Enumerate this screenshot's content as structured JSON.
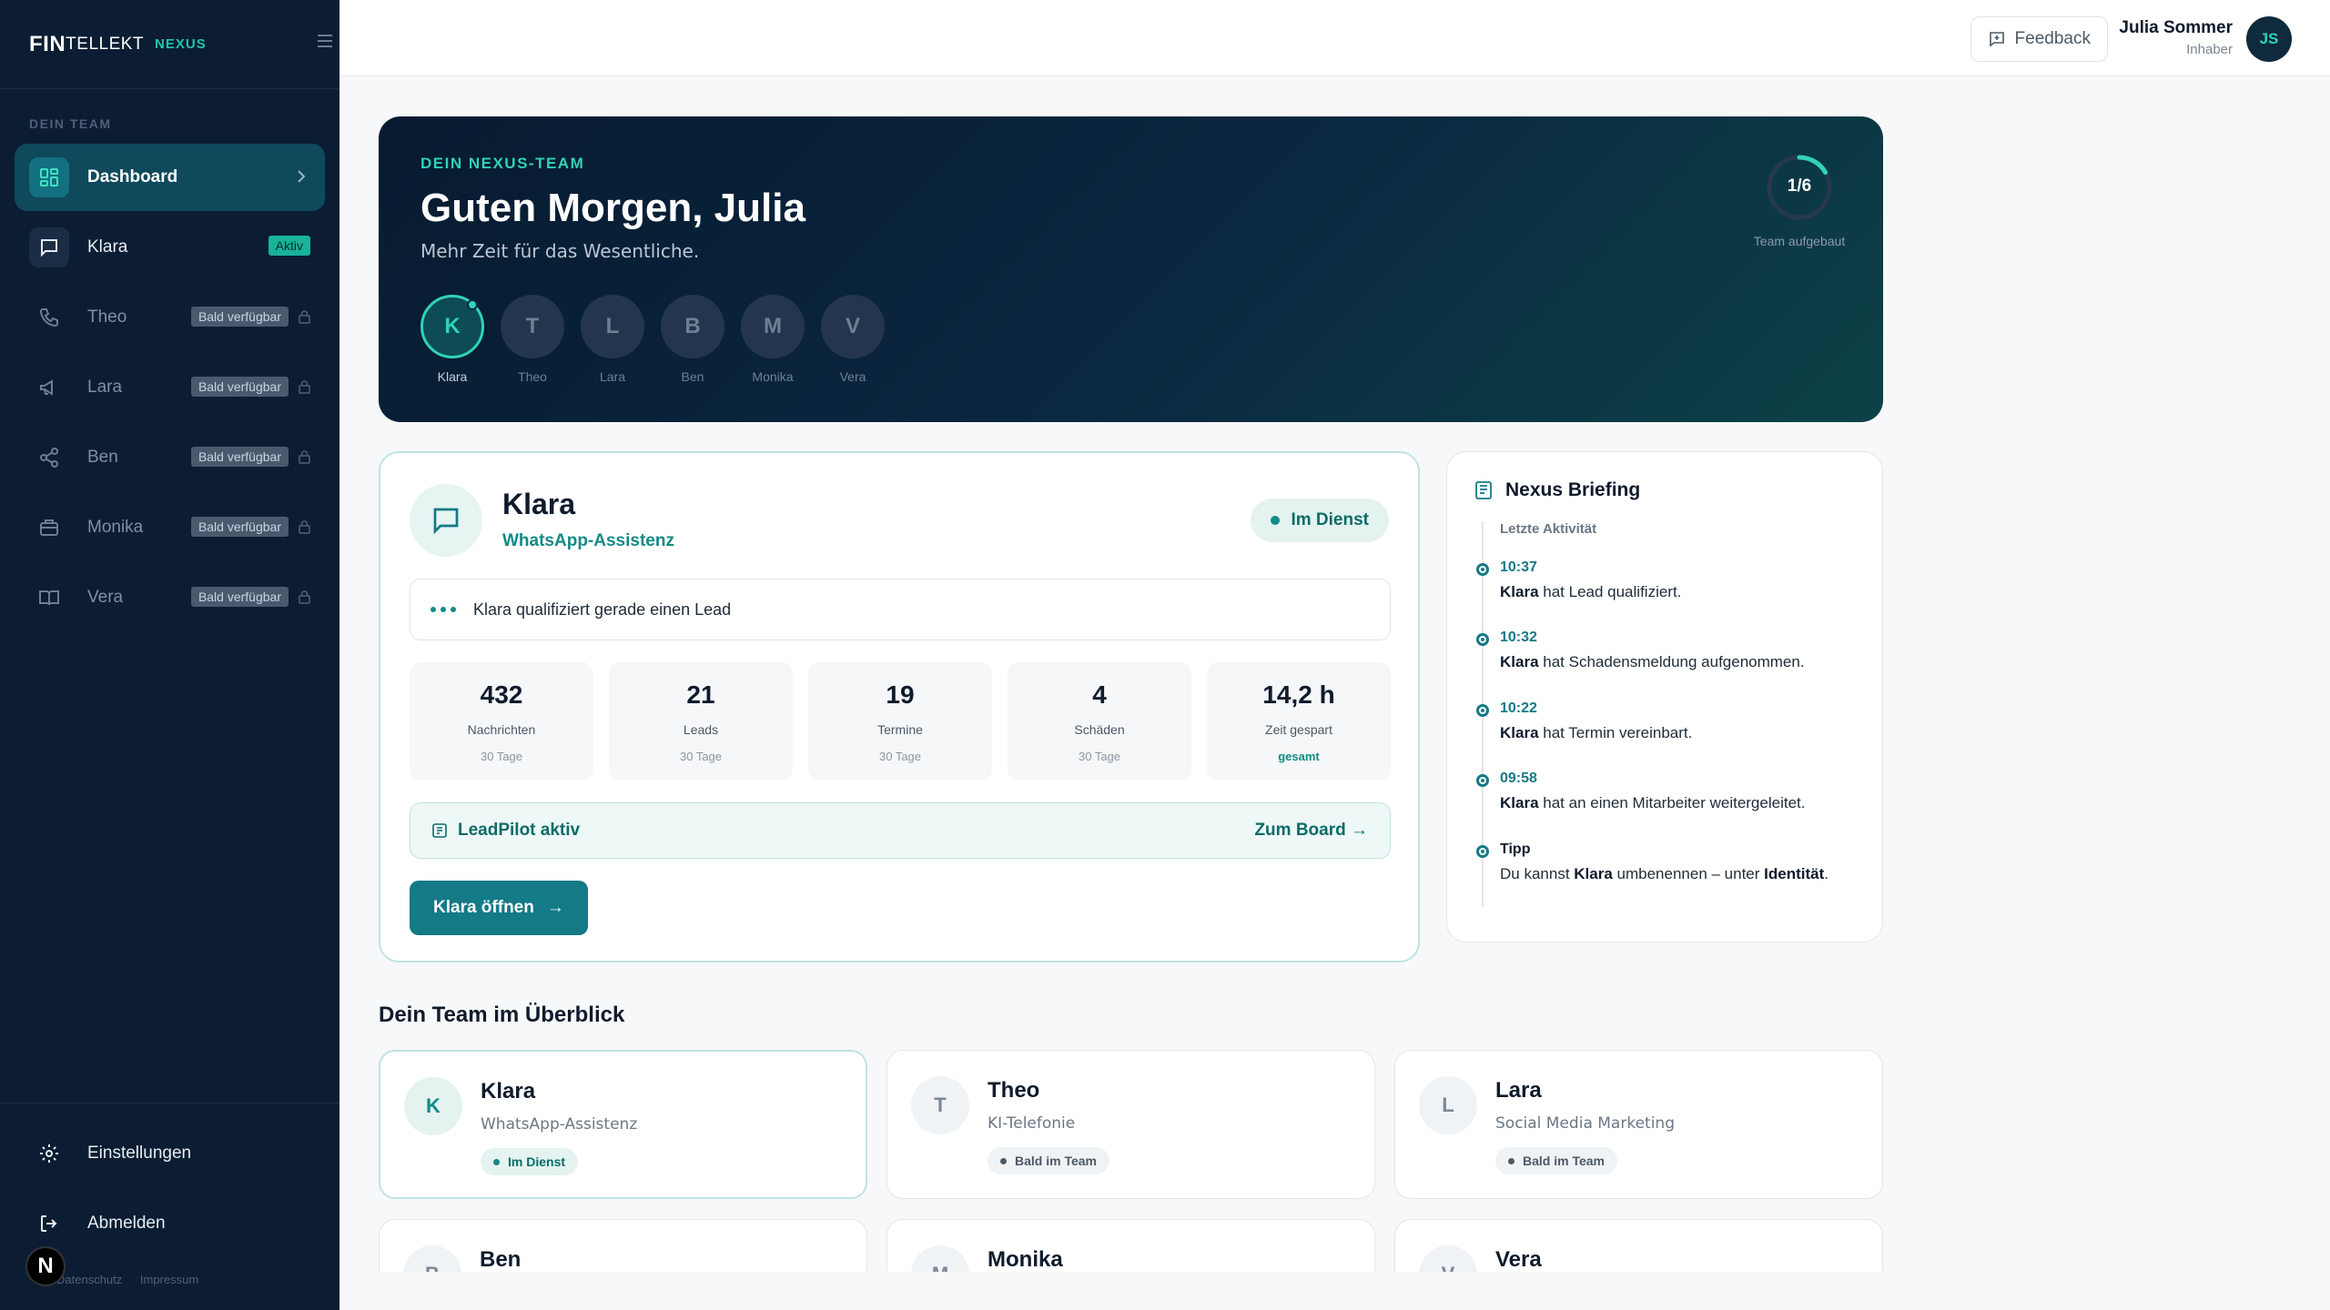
{
  "brand": {
    "fin": "FIN",
    "tellekt": "TELLEKT",
    "nexus": "NEXUS"
  },
  "sidebar": {
    "section_label": "DEIN TEAM",
    "items": [
      {
        "label": "Dashboard",
        "icon": "grid-icon",
        "active": true
      },
      {
        "label": "Klara",
        "icon": "chat-icon",
        "badge": "Aktiv"
      },
      {
        "label": "Theo",
        "icon": "phone-icon",
        "badge": "Bald verfügbar"
      },
      {
        "label": "Lara",
        "icon": "megaphone-icon",
        "badge": "Bald verfügbar"
      },
      {
        "label": "Ben",
        "icon": "share-icon",
        "badge": "Bald verfügbar"
      },
      {
        "label": "Monika",
        "icon": "inbox-icon",
        "badge": "Bald verfügbar"
      },
      {
        "label": "Vera",
        "icon": "book-icon",
        "badge": "Bald verfügbar"
      }
    ],
    "settings_label": "Einstellungen",
    "logout_label": "Abmelden",
    "legal_privacy": "Datenschutz",
    "legal_imprint": "Impressum",
    "n_badge": "N"
  },
  "topbar": {
    "feedback_label": "Feedback",
    "user_name": "Julia Sommer",
    "user_role": "Inhaber",
    "user_initials": "JS"
  },
  "hero": {
    "kicker": "DEIN NEXUS-TEAM",
    "title": "Guten Morgen, Julia",
    "subtitle": "Mehr Zeit für das Wesentliche.",
    "members": [
      {
        "initial": "K",
        "name": "Klara"
      },
      {
        "initial": "T",
        "name": "Theo"
      },
      {
        "initial": "L",
        "name": "Lara"
      },
      {
        "initial": "B",
        "name": "Ben"
      },
      {
        "initial": "M",
        "name": "Monika"
      },
      {
        "initial": "V",
        "name": "Vera"
      }
    ],
    "progress_value": "1/6",
    "progress_fraction": 0.1667,
    "progress_caption": "Team aufgebaut"
  },
  "agent": {
    "name": "Klara",
    "role": "WhatsApp-Assistenz",
    "status": "Im Dienst",
    "activity": "Klara qualifiziert gerade einen Lead",
    "stats": [
      {
        "value": "432",
        "label": "Nachrichten",
        "sub": "30 Tage"
      },
      {
        "value": "21",
        "label": "Leads",
        "sub": "30 Tage"
      },
      {
        "value": "19",
        "label": "Termine",
        "sub": "30 Tage"
      },
      {
        "value": "4",
        "label": "Schäden",
        "sub": "30 Tage"
      },
      {
        "value": "14,2 h",
        "label": "Zeit gespart",
        "sub": "gesamt"
      }
    ],
    "leadpilot_label": "LeadPilot aktiv",
    "leadpilot_link": "Zum Board",
    "open_button": "Klara öffnen"
  },
  "briefing": {
    "title": "Nexus Briefing",
    "section": "Letzte Aktivität",
    "items": [
      {
        "time": "10:37",
        "actor": "Klara",
        "text": " hat Lead qualifiziert."
      },
      {
        "time": "10:32",
        "actor": "Klara",
        "text": " hat Schadensmeldung aufgenommen."
      },
      {
        "time": "10:22",
        "actor": "Klara",
        "text": " hat Termin vereinbart."
      },
      {
        "time": "09:58",
        "actor": "Klara",
        "text": " hat an einen Mitarbeiter weitergeleitet."
      }
    ],
    "tip_label": "Tipp",
    "tip_pre": "Du kannst ",
    "tip_actor": "Klara",
    "tip_mid": " umbenennen – unter ",
    "tip_target": "Identität",
    "tip_end": "."
  },
  "team": {
    "title": "Dein Team im Überblick",
    "cards": [
      {
        "initial": "K",
        "name": "Klara",
        "role": "WhatsApp-Assistenz",
        "status": "Im Dienst"
      },
      {
        "initial": "T",
        "name": "Theo",
        "role": "KI-Telefonie",
        "status": "Bald im Team"
      },
      {
        "initial": "L",
        "name": "Lara",
        "role": "Social Media Marketing",
        "status": "Bald im Team"
      },
      {
        "initial": "B",
        "name": "Ben",
        "role": "",
        "status": ""
      },
      {
        "initial": "M",
        "name": "Monika",
        "role": "",
        "status": ""
      },
      {
        "initial": "V",
        "name": "Vera",
        "role": "",
        "status": ""
      }
    ]
  },
  "colors": {
    "accent": "#2fd3b5",
    "primary": "#137a86",
    "sidebar": "#0c1d33"
  }
}
